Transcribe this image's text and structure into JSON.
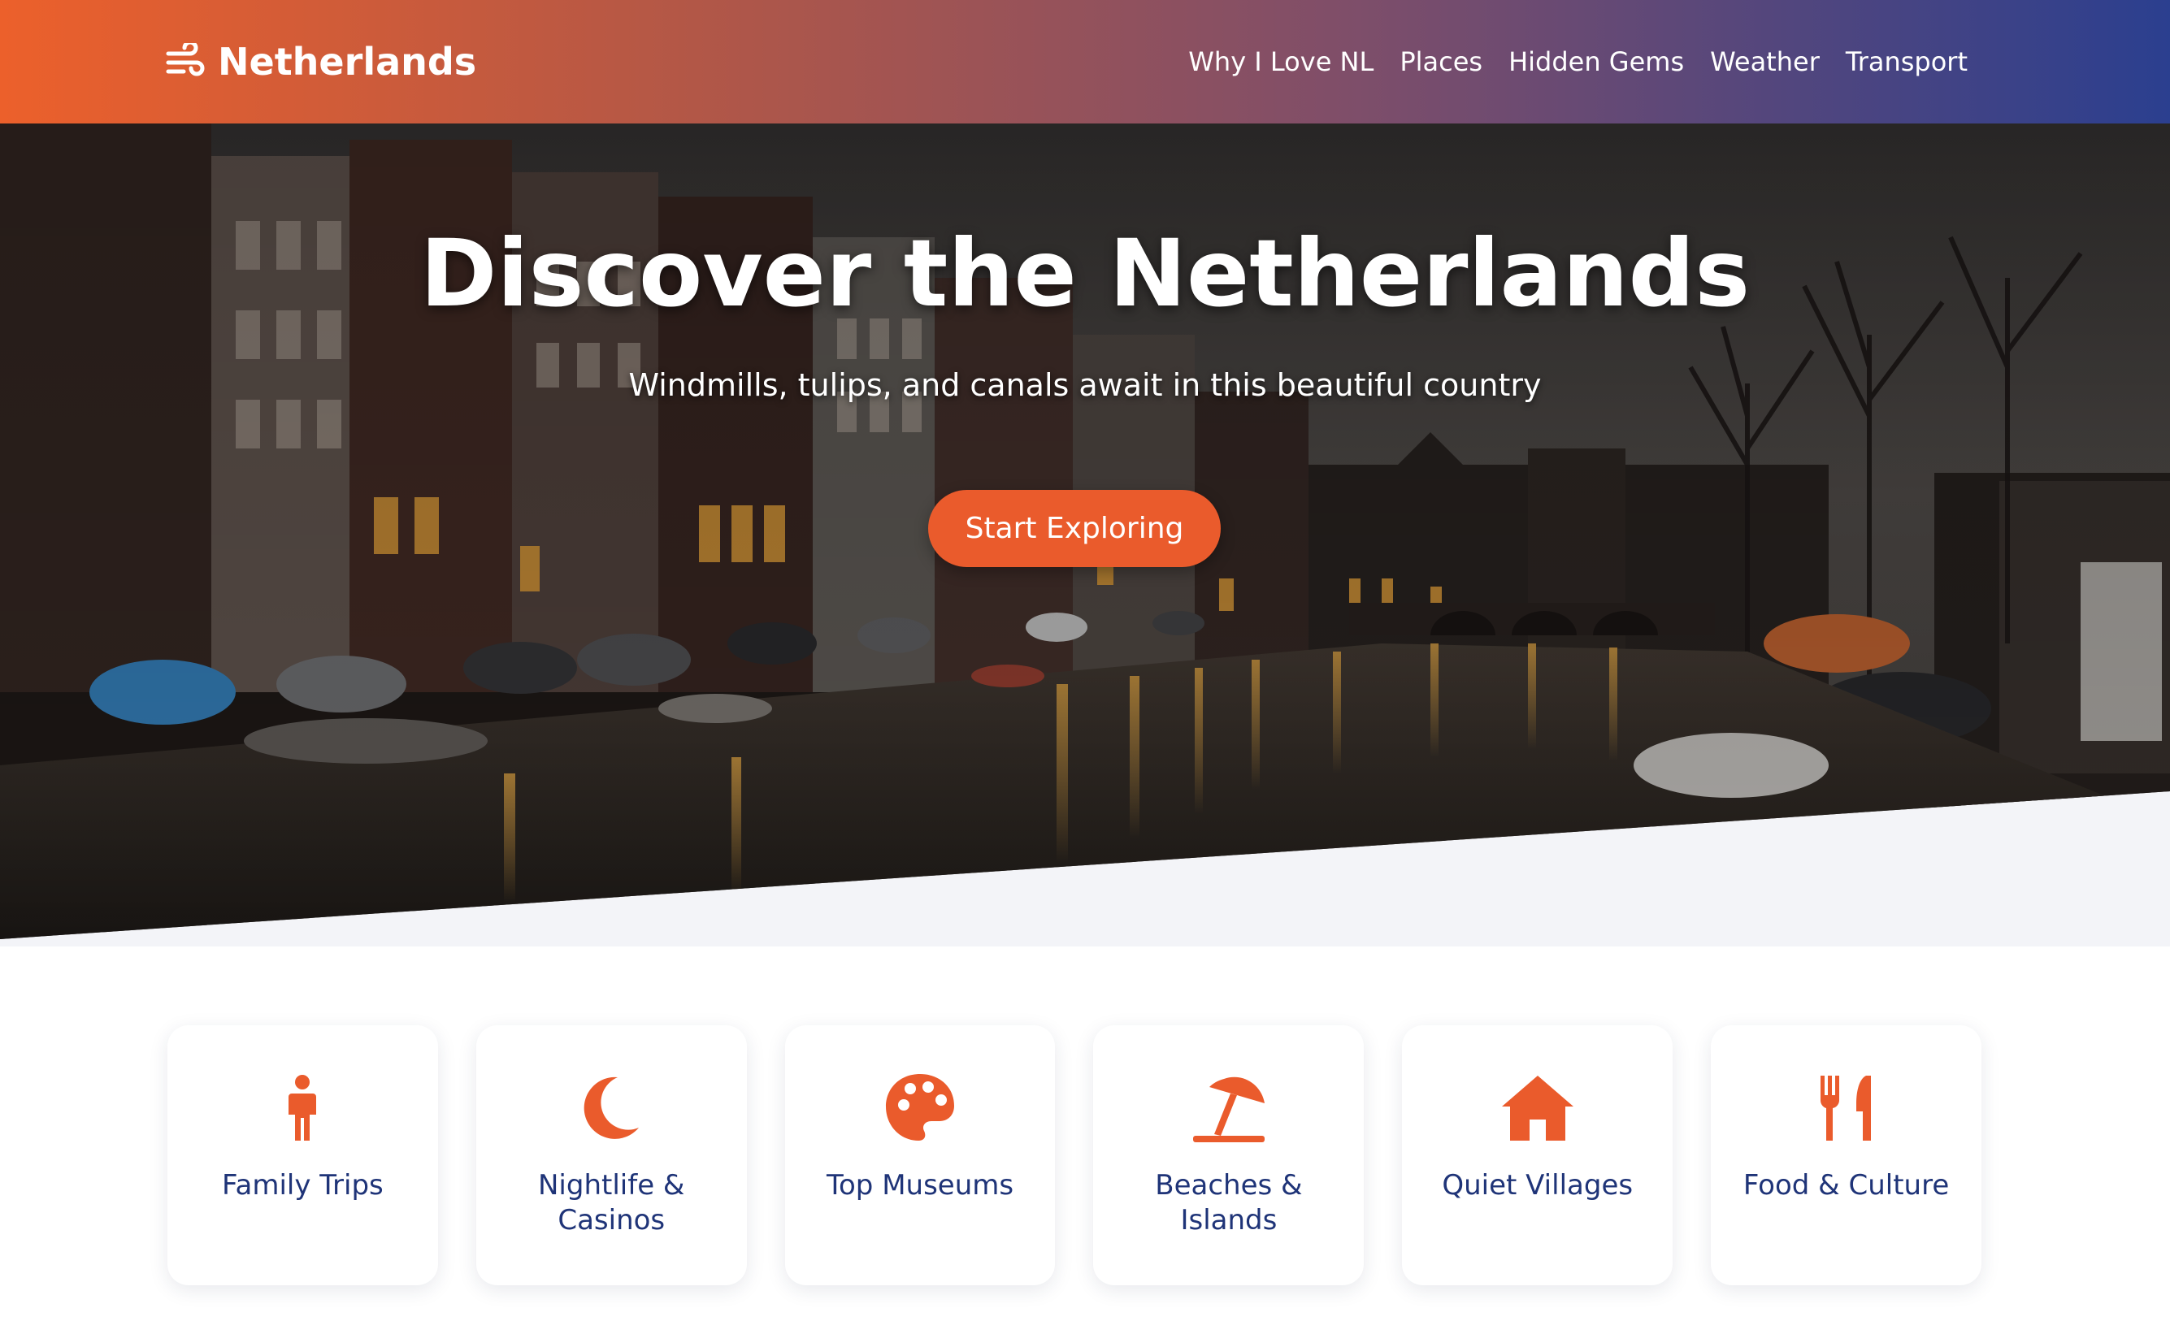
{
  "header": {
    "logo_icon": "wind-icon",
    "brand": "Netherlands",
    "nav": [
      {
        "label": "Why I Love NL"
      },
      {
        "label": "Places"
      },
      {
        "label": "Hidden Gems"
      },
      {
        "label": "Weather"
      },
      {
        "label": "Transport"
      }
    ]
  },
  "hero": {
    "title": "Discover the Netherlands",
    "subtitle": "Windmills, tulips, and canals await in this beautiful country",
    "cta_label": "Start Exploring",
    "image_subject": "amsterdam-canal-at-dusk"
  },
  "categories": [
    {
      "label": "Family Trips",
      "icon": "child-icon"
    },
    {
      "label": "Nightlife & Casinos",
      "icon": "moon-icon"
    },
    {
      "label": "Top Museums",
      "icon": "palette-icon"
    },
    {
      "label": "Beaches & Islands",
      "icon": "umbrella-beach-icon"
    },
    {
      "label": "Quiet Villages",
      "icon": "house-icon"
    },
    {
      "label": "Food & Culture",
      "icon": "utensils-icon"
    }
  ],
  "colors": {
    "accent": "#ea5b2c",
    "header_gradient_start": "#ec602b",
    "header_gradient_end": "#2b3f8f",
    "card_text": "#1f3478",
    "band": "#f3f4f8"
  }
}
